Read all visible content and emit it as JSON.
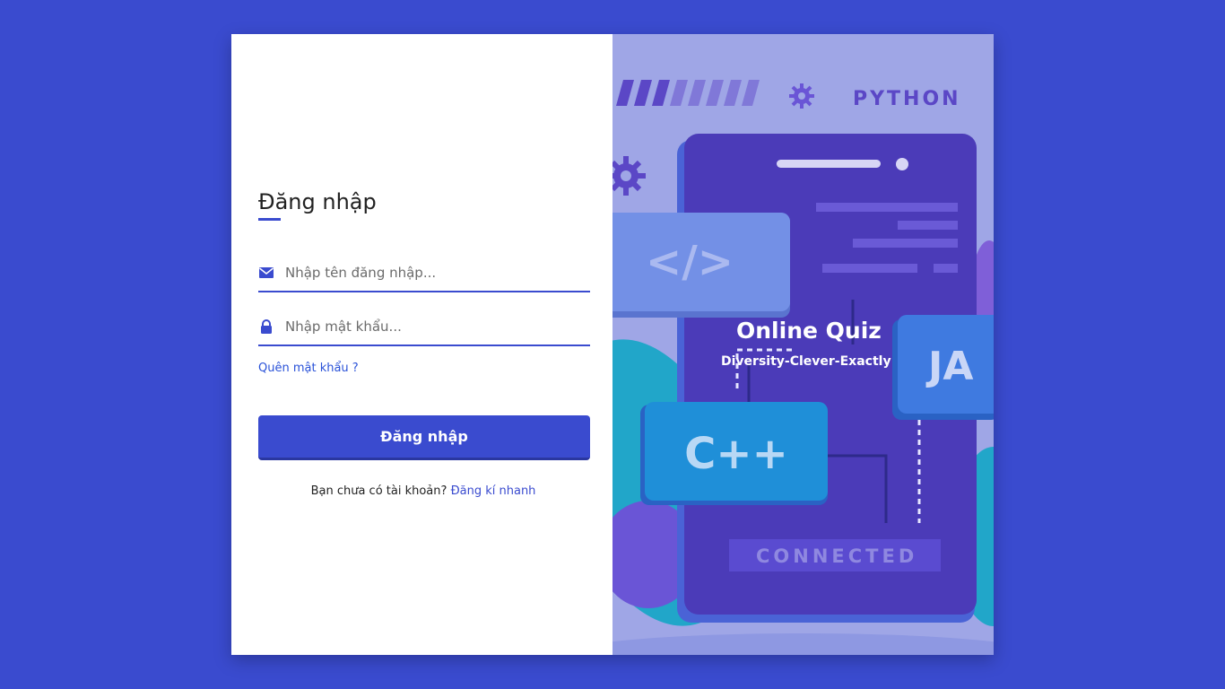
{
  "login": {
    "title": "Đăng nhập",
    "username_placeholder": "Nhập tên đăng nhập...",
    "password_placeholder": "Nhập mật khẩu...",
    "forgot_password": "Quên mật khẩu ?",
    "submit_label": "Đăng nhập",
    "no_account_text": "Bạn chưa có tài khoản?",
    "signup_link": "Đăng kí nhanh"
  },
  "illustration": {
    "brand_title": "Online Quiz",
    "brand_tagline": "Diversity-Clever-Exactly",
    "badge_python": "PYTHON",
    "badge_connected": "CONNECTED",
    "card_code": "</>",
    "card_cpp": "C++",
    "card_java": "JA"
  },
  "colors": {
    "background": "#3a4bcf",
    "accent": "#3a4bcf",
    "link": "#2a52d8",
    "illustration_bg": "#9fa6e6"
  },
  "icons": [
    "envelope-icon",
    "lock-icon",
    "gear-icon"
  ]
}
